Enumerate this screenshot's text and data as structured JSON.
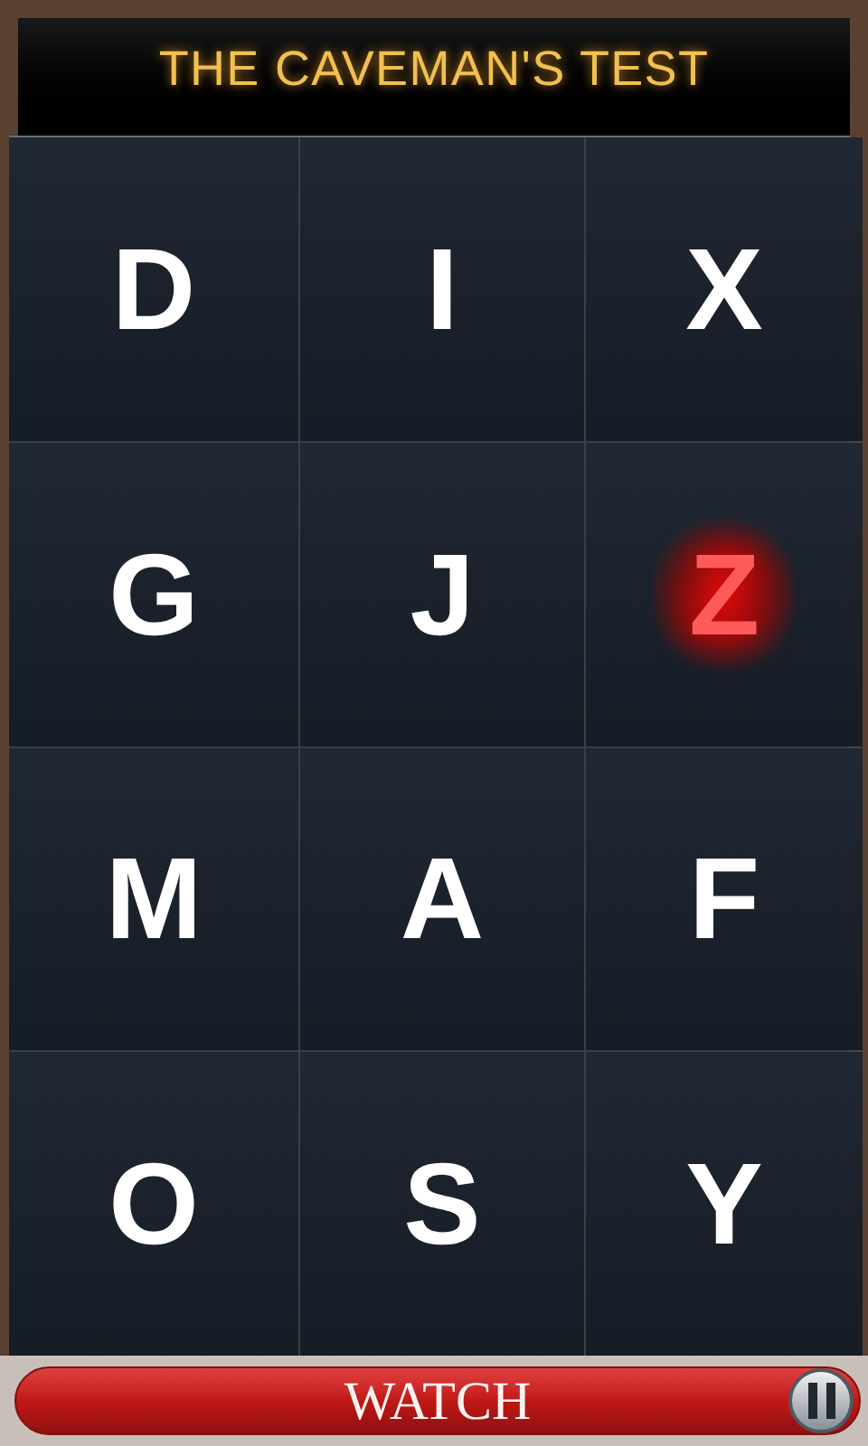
{
  "header": {
    "title": "THE CAVEMAN'S TEST"
  },
  "tiles": [
    {
      "letter": "D",
      "selected": false
    },
    {
      "letter": "I",
      "selected": false
    },
    {
      "letter": "X",
      "selected": false
    },
    {
      "letter": "G",
      "selected": false
    },
    {
      "letter": "J",
      "selected": false
    },
    {
      "letter": "Z",
      "selected": true
    },
    {
      "letter": "M",
      "selected": false
    },
    {
      "letter": "A",
      "selected": false
    },
    {
      "letter": "F",
      "selected": false
    },
    {
      "letter": "O",
      "selected": false
    },
    {
      "letter": "S",
      "selected": false
    },
    {
      "letter": "Y",
      "selected": false
    }
  ],
  "bottom_bar": {
    "button": "WATCH"
  }
}
